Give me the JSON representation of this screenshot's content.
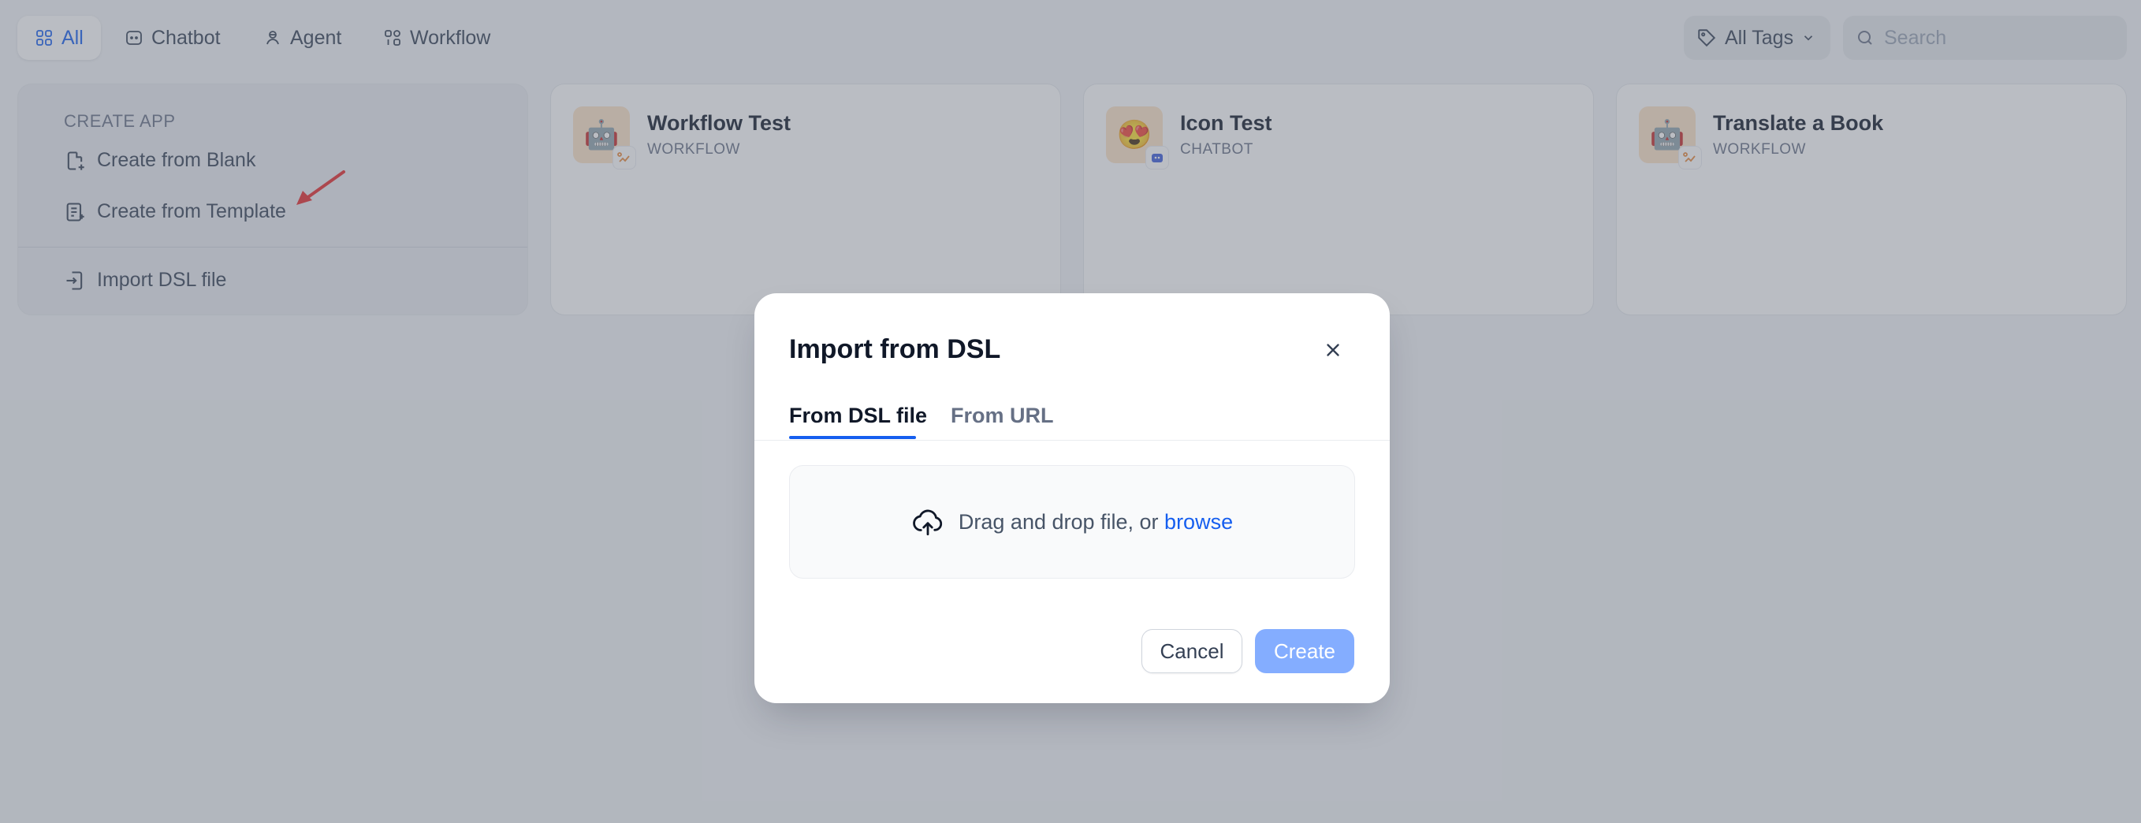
{
  "tabs": [
    {
      "label": "All",
      "icon": "grid-icon",
      "active": true
    },
    {
      "label": "Chatbot",
      "icon": "chat-icon"
    },
    {
      "label": "Agent",
      "icon": "agent-icon"
    },
    {
      "label": "Workflow",
      "icon": "workflow-icon"
    }
  ],
  "tags_filter": {
    "label": "All Tags"
  },
  "search": {
    "placeholder": "Search"
  },
  "create_app": {
    "title": "CREATE APP",
    "items": [
      {
        "label": "Create from Blank",
        "icon": "file-plus-icon"
      },
      {
        "label": "Create from Template",
        "icon": "template-icon"
      },
      {
        "label": "Import DSL file",
        "icon": "import-icon"
      }
    ]
  },
  "apps": [
    {
      "name": "Workflow Test",
      "type": "WORKFLOW",
      "icon": "robot-emoji",
      "badge": "workflow-badge-icon"
    },
    {
      "name": "Icon Test",
      "type": "CHATBOT",
      "icon": "heart-eyes-emoji",
      "badge": "chatbot-badge-icon"
    },
    {
      "name": "Translate a Book",
      "type": "WORKFLOW",
      "icon": "robot-emoji",
      "badge": "workflow-badge-icon"
    }
  ],
  "modal": {
    "title": "Import from DSL",
    "tabs": [
      "From DSL file",
      "From URL"
    ],
    "active_tab": "From DSL file",
    "dropzone_text": "Drag and drop file, or ",
    "browse_label": "browse",
    "cancel_label": "Cancel",
    "create_label": "Create"
  },
  "colors": {
    "accent": "#155eef",
    "create_disabled": "#84adff",
    "annotation_arrow": "#e5282a"
  }
}
